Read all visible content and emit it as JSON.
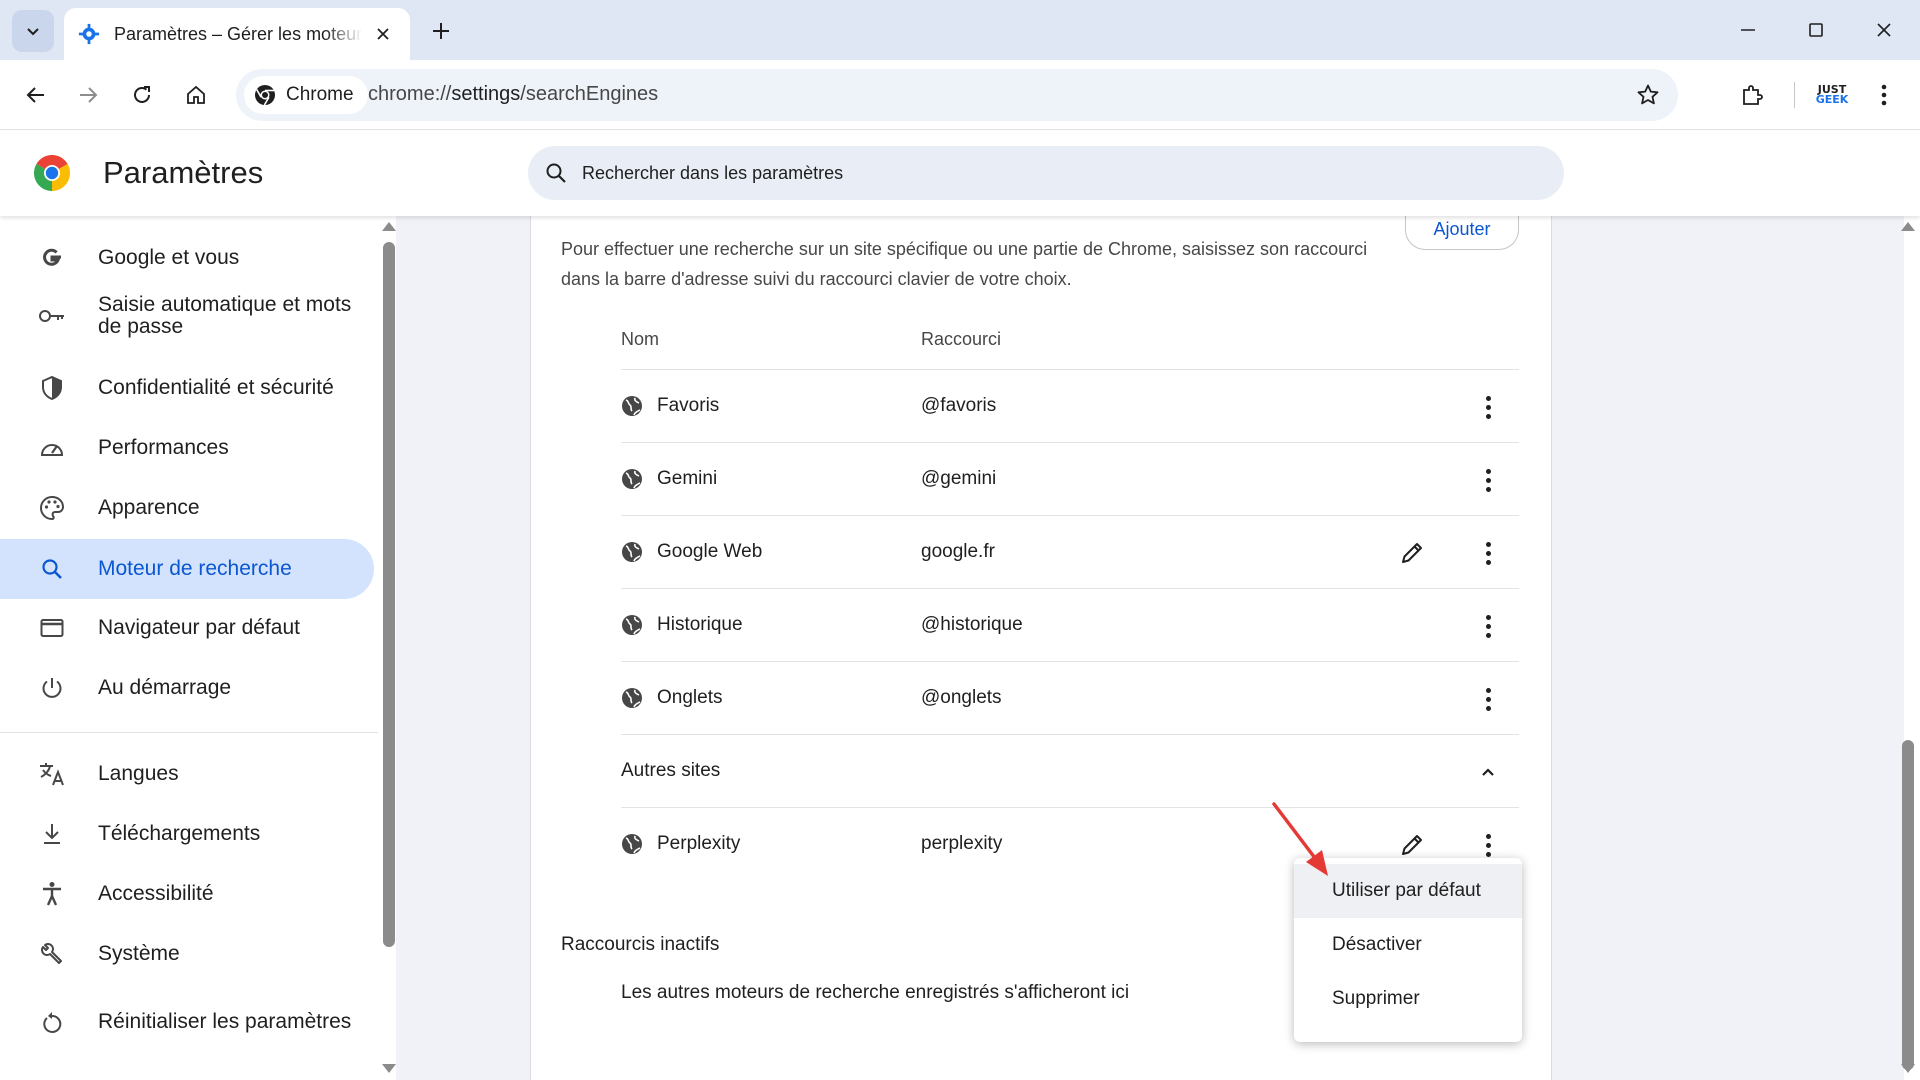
{
  "browser": {
    "tab_title": "Paramètres – Gérer les moteurs de recherche",
    "omnibox_chip": "Chrome",
    "url_scheme": "chrome://",
    "url_host": "settings",
    "url_path": "/searchEngines",
    "profile_logo_line1": "JUST",
    "profile_logo_line2": "GEEK"
  },
  "settings": {
    "title": "Paramètres",
    "search_placeholder": "Rechercher dans les paramètres"
  },
  "sidebar": {
    "items": [
      {
        "label": "Google et vous",
        "icon": "google-g-icon"
      },
      {
        "label": "Saisie automatique et mots de passe",
        "icon": "key-icon"
      },
      {
        "label": "Confidentialité et sécurité",
        "icon": "shield-icon"
      },
      {
        "label": "Performances",
        "icon": "speedometer-icon"
      },
      {
        "label": "Apparence",
        "icon": "palette-icon"
      },
      {
        "label": "Moteur de recherche",
        "icon": "search-icon",
        "active": true
      },
      {
        "label": "Navigateur par défaut",
        "icon": "browser-window-icon"
      },
      {
        "label": "Au démarrage",
        "icon": "power-icon"
      },
      {
        "label": "Langues",
        "icon": "translate-icon"
      },
      {
        "label": "Téléchargements",
        "icon": "download-icon"
      },
      {
        "label": "Accessibilité",
        "icon": "accessibility-icon"
      },
      {
        "label": "Système",
        "icon": "wrench-icon"
      },
      {
        "label": "Réinitialiser les paramètres",
        "icon": "reset-icon"
      }
    ]
  },
  "main": {
    "add_button": "Ajouter",
    "description": "Pour effectuer une recherche sur un site spécifique ou une partie de Chrome, saisissez son raccourci dans la barre d'adresse suivi du raccourci clavier de votre choix.",
    "col_name": "Nom",
    "col_shortcut": "Raccourci",
    "rows": [
      {
        "name": "Favoris",
        "shortcut": "@favoris"
      },
      {
        "name": "Gemini",
        "shortcut": "@gemini"
      },
      {
        "name": "Google Web",
        "shortcut": "google.fr",
        "editable": true
      },
      {
        "name": "Historique",
        "shortcut": "@historique"
      },
      {
        "name": "Onglets",
        "shortcut": "@onglets"
      }
    ],
    "other_sites_label": "Autres sites",
    "other_rows": [
      {
        "name": "Perplexity",
        "shortcut": "perplexity",
        "editable": true
      }
    ],
    "inactive_title": "Raccourcis inactifs",
    "inactive_text": "Les autres moteurs de recherche enregistrés s'afficheront ici"
  },
  "menu": {
    "items": [
      "Utiliser par défaut",
      "Désactiver",
      "Supprimer"
    ]
  },
  "colors": {
    "accent": "#0b57d0",
    "active_nav_bg": "#d3e3fd",
    "annotation_arrow": "#e53935"
  }
}
